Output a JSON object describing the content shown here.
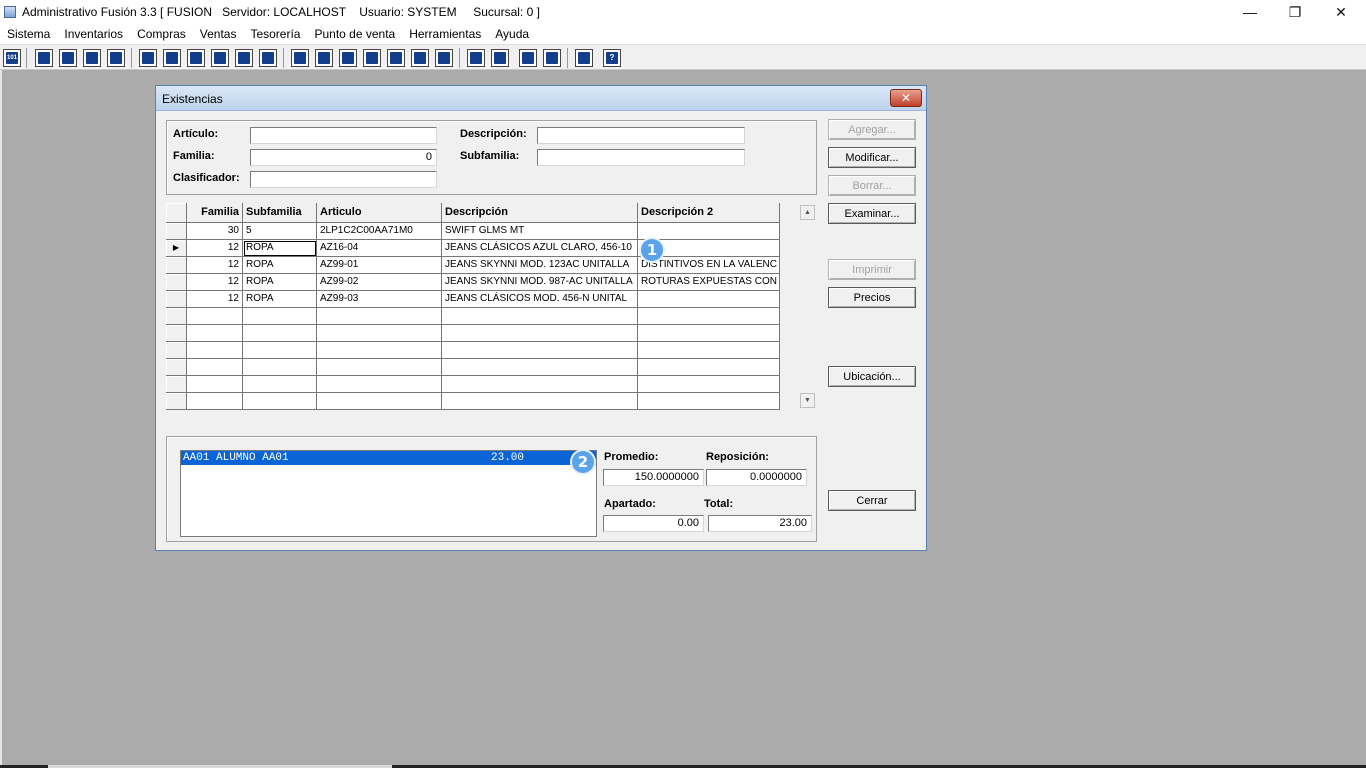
{
  "window": {
    "title": "Administrativo Fusión 3.3 [ FUSION   Servidor: LOCALHOST    Usuario: SYSTEM     Sucursal: 0 ]",
    "minimize_icon": "minimize-icon",
    "maximize_icon": "restore-icon",
    "close_icon": "close-icon",
    "minimize": "—",
    "restore": "❐",
    "close": "✕"
  },
  "menu": [
    "Sistema",
    "Inventarios",
    "Compras",
    "Ventas",
    "Tesorería",
    "Punto de venta",
    "Herramientas",
    "Ayuda"
  ],
  "toolbar": {
    "first_glyph": "101",
    "help_glyph": "?",
    "icons": [
      "calculator-icon",
      "copy-icon",
      "paste-icon",
      "swap-icon",
      "search-icon",
      "user-icon",
      "folder-icon",
      "printer-icon",
      "print-preview-icon",
      "document-icon",
      "list-icon",
      "people-icon",
      "card-icon",
      "export-icon",
      "add-icon",
      "money-icon",
      "report-icon",
      "table-icon",
      "home-icon",
      "zoom-icon",
      "refresh-icon",
      "undo-icon",
      "back-icon",
      "help-icon"
    ]
  },
  "dialog": {
    "title": "Existencias",
    "close": "✕",
    "filters": {
      "articulo_label": "Artículo:",
      "articulo_value": "",
      "descripcion_label": "Descripción:",
      "descripcion_value": "",
      "familia_label": "Familia:",
      "familia_value": "0",
      "subfamilia_label": "Subfamilia:",
      "subfamilia_value": "",
      "clasificador_label": "Clasificador:",
      "clasificador_value": ""
    },
    "buttons": {
      "agregar": "Agregar...",
      "modificar": "Modificar...",
      "borrar": "Borrar...",
      "examinar": "Examinar...",
      "imprimir": "Imprimir",
      "precios": "Precios",
      "ubicacion": "Ubicación...",
      "cerrar": "Cerrar"
    },
    "grid": {
      "columns": [
        "Familia",
        "Subfamilia",
        "Articulo",
        "Descripción",
        "Descripción 2"
      ],
      "rows": [
        [
          "30",
          "5",
          "2LP1C2C00AA71M0",
          "SWIFT GLMS MT",
          ""
        ],
        [
          "12",
          "ROPA",
          "AZ16-04",
          "JEANS CLÁSICOS AZUL CLARO, 456-10",
          ""
        ],
        [
          "12",
          "ROPA",
          "AZ99-01",
          "JEANS SKYNNI MOD. 123AC  UNITALLA",
          "DISTINTIVOS EN LA VALENC"
        ],
        [
          "12",
          "ROPA",
          "AZ99-02",
          "JEANS SKYNNI MOD. 987-AC  UNITALLA",
          "ROTURAS EXPUESTAS CON"
        ],
        [
          "12",
          "ROPA",
          "AZ99-03",
          "JEANS CLÁSICOS MOD. 456-N  UNITAL",
          ""
        ]
      ],
      "current_row_marker": "▶",
      "scroll_up": "▲",
      "scroll_down": "▼"
    },
    "stock": {
      "list": [
        {
          "label": "AA01 ALUMNO AA01",
          "qty": "23.00"
        }
      ],
      "promedio_label": "Promedio:",
      "promedio_value": "150.0000000",
      "reposicion_label": "Reposición:",
      "reposicion_value": "0.0000000",
      "apartado_label": "Apartado:",
      "apartado_value": "0.00",
      "total_label": "Total:",
      "total_value": "23.00"
    },
    "badges": [
      "1",
      "2"
    ]
  },
  "colors": {
    "desktop": "#ababab",
    "selection": "#0a64d6",
    "badge": "#5ba3e8"
  }
}
